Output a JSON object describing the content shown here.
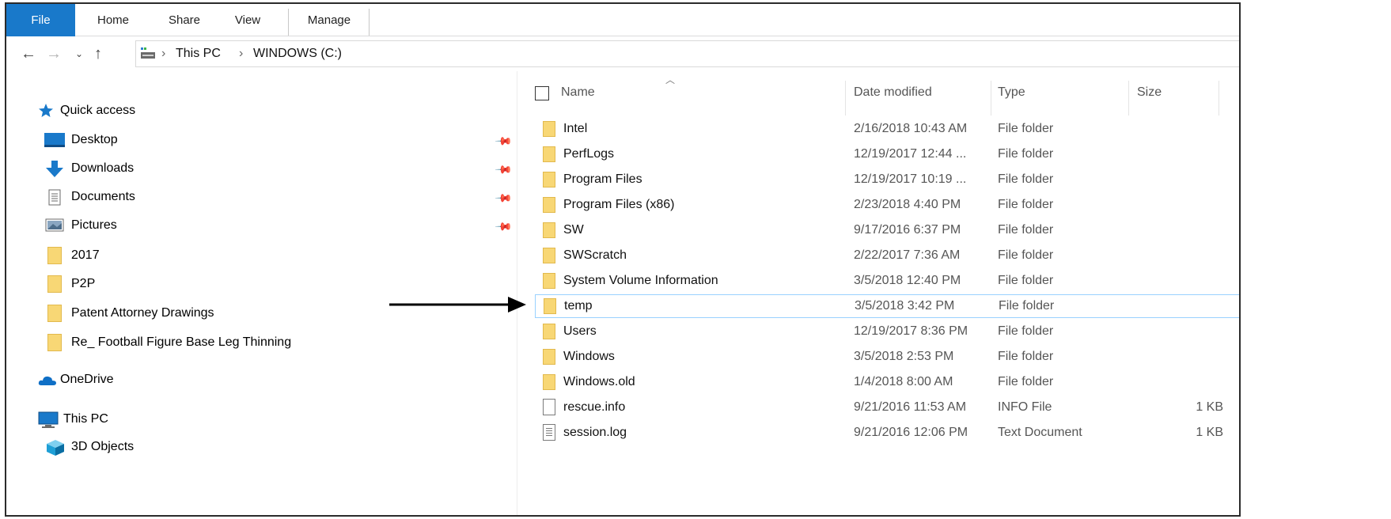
{
  "ribbon": {
    "tabs": [
      {
        "label": "File"
      },
      {
        "label": "Home"
      },
      {
        "label": "Share"
      },
      {
        "label": "View"
      },
      {
        "label": "Manage"
      }
    ]
  },
  "address": {
    "back_icon": "back-arrow-icon",
    "forward_icon": "forward-arrow-icon",
    "recent_icon": "chevron-down-icon",
    "up_icon": "up-arrow-icon",
    "segments": [
      "This PC",
      "WINDOWS (C:)"
    ],
    "separator": "›"
  },
  "navpane": {
    "quick_access": "Quick access",
    "items": [
      {
        "label": "Desktop",
        "icon": "desktop-icon",
        "pinned": true
      },
      {
        "label": "Downloads",
        "icon": "download-icon",
        "pinned": true
      },
      {
        "label": "Documents",
        "icon": "documents-icon",
        "pinned": true
      },
      {
        "label": "Pictures",
        "icon": "pictures-icon",
        "pinned": true
      },
      {
        "label": "2017",
        "icon": "folder-icon",
        "pinned": false
      },
      {
        "label": "P2P",
        "icon": "folder-icon",
        "pinned": false
      },
      {
        "label": "Patent Attorney Drawings",
        "icon": "folder-icon",
        "pinned": false
      },
      {
        "label": "Re_ Football Figure Base Leg Thinning",
        "icon": "folder-icon",
        "pinned": false
      }
    ],
    "onedrive": "OneDrive",
    "this_pc": "This PC",
    "objects3d": "3D Objects"
  },
  "columns": {
    "name": "Name",
    "date": "Date modified",
    "type": "Type",
    "size": "Size"
  },
  "files": [
    {
      "name": "Intel",
      "date": "2/16/2018 10:43 AM",
      "type": "File folder",
      "size": "",
      "kind": "folder"
    },
    {
      "name": "PerfLogs",
      "date": "12/19/2017 12:44 ...",
      "type": "File folder",
      "size": "",
      "kind": "folder"
    },
    {
      "name": "Program Files",
      "date": "12/19/2017 10:19 ...",
      "type": "File folder",
      "size": "",
      "kind": "folder"
    },
    {
      "name": "Program Files (x86)",
      "date": "2/23/2018 4:40 PM",
      "type": "File folder",
      "size": "",
      "kind": "folder"
    },
    {
      "name": "SW",
      "date": "9/17/2016 6:37 PM",
      "type": "File folder",
      "size": "",
      "kind": "folder"
    },
    {
      "name": "SWScratch",
      "date": "2/22/2017 7:36 AM",
      "type": "File folder",
      "size": "",
      "kind": "folder"
    },
    {
      "name": "System Volume Information",
      "date": "3/5/2018 12:40 PM",
      "type": "File folder",
      "size": "",
      "kind": "folder"
    },
    {
      "name": "temp",
      "date": "3/5/2018 3:42 PM",
      "type": "File folder",
      "size": "",
      "kind": "folder",
      "selected": true
    },
    {
      "name": "Users",
      "date": "12/19/2017 8:36 PM",
      "type": "File folder",
      "size": "",
      "kind": "folder"
    },
    {
      "name": "Windows",
      "date": "3/5/2018 2:53 PM",
      "type": "File folder",
      "size": "",
      "kind": "folder"
    },
    {
      "name": "Windows.old",
      "date": "1/4/2018 8:00 AM",
      "type": "File folder",
      "size": "",
      "kind": "folder"
    },
    {
      "name": "rescue.info",
      "date": "9/21/2016 11:53 AM",
      "type": "INFO File",
      "size": "1 KB",
      "kind": "file"
    },
    {
      "name": "session.log",
      "date": "9/21/2016 12:06 PM",
      "type": "Text Document",
      "size": "1 KB",
      "kind": "text"
    }
  ],
  "colors": {
    "file_tab": "#1979ca",
    "folder": "#f8d775",
    "selection_border": "#99d1ff",
    "quick_access_star": "#1979ca",
    "onedrive": "#0f6fc6"
  }
}
